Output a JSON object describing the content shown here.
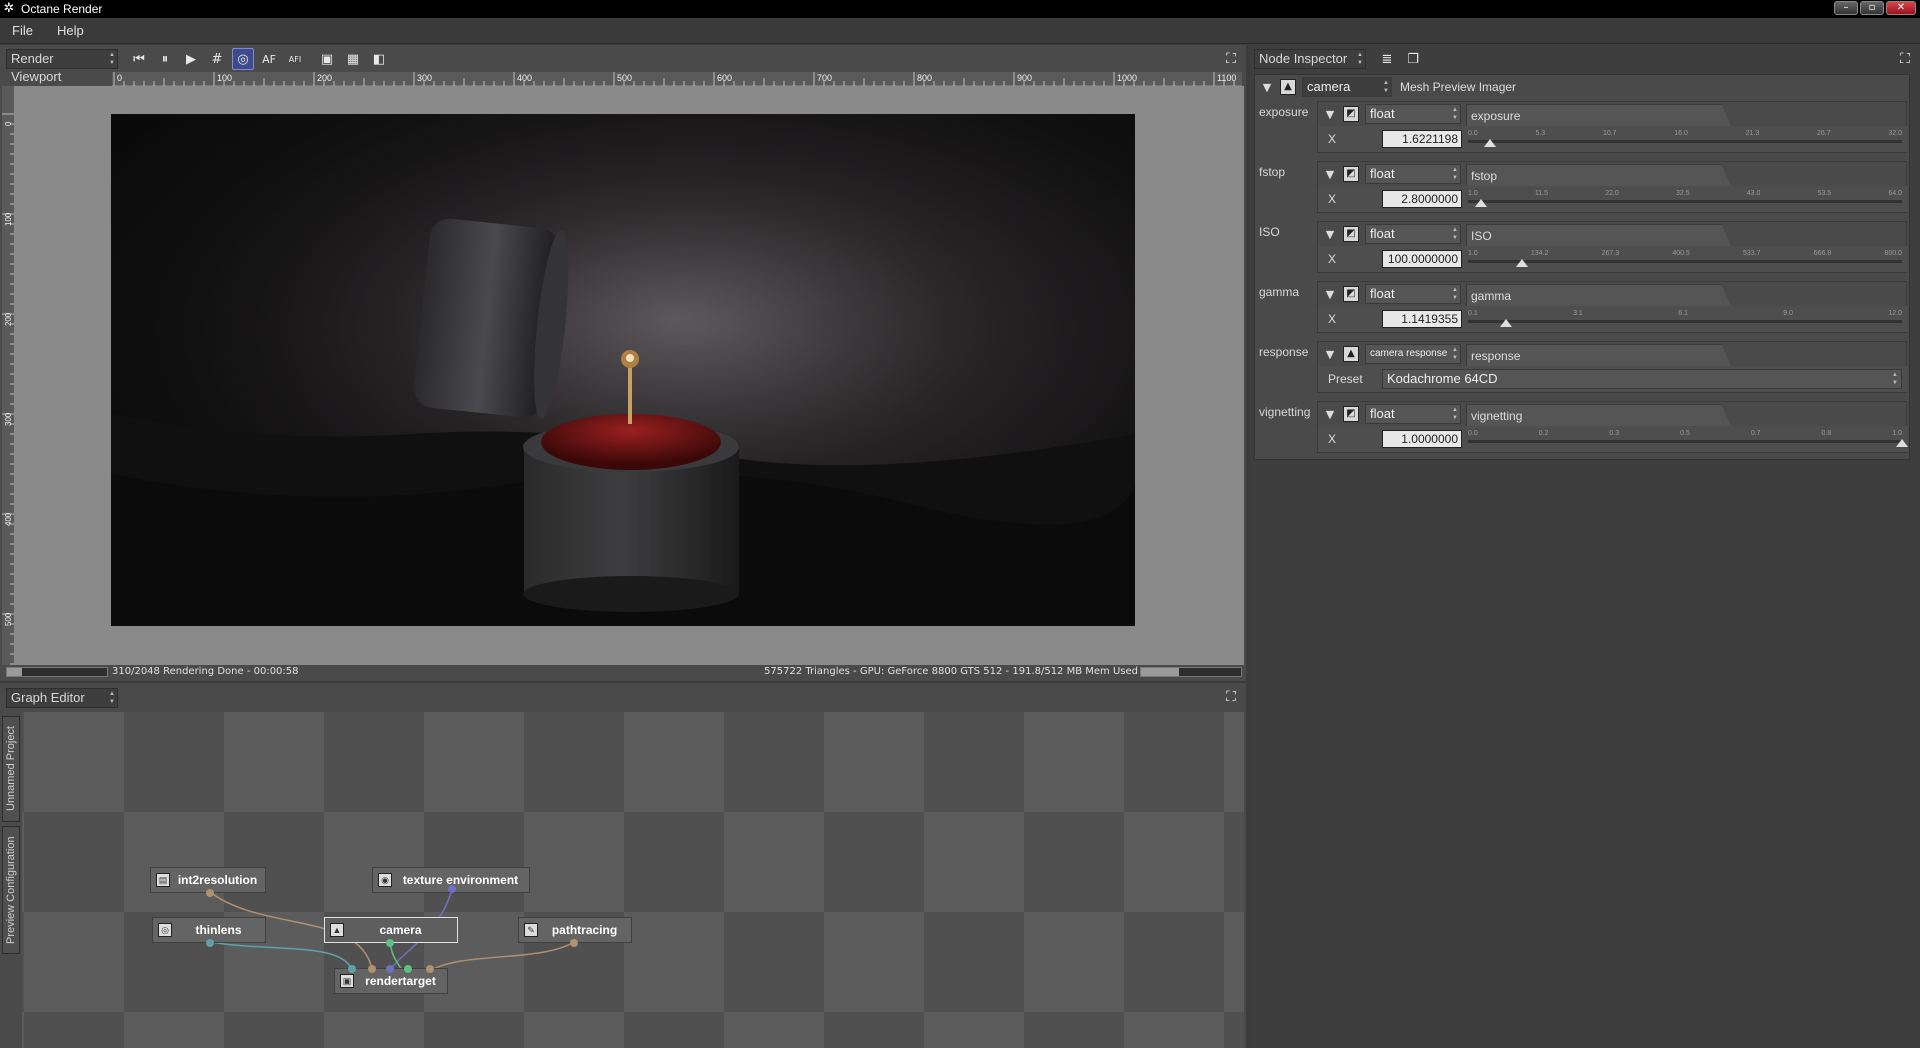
{
  "window": {
    "title": "Octane Render",
    "controls": [
      "–",
      "▫",
      "✕"
    ]
  },
  "menu": [
    "File",
    "Help"
  ],
  "viewport": {
    "panel_label": "Render Viewport",
    "toolbar": {
      "rewind": "⏮",
      "pause": "⏸",
      "play": "▶",
      "grid": "#",
      "focus": "◎",
      "af": "AF",
      "afi": "AFI",
      "region": "▣",
      "checker": "▦",
      "alpha": "◧"
    },
    "ruler_h": [
      "0",
      "100",
      "200",
      "300",
      "400",
      "500",
      "600",
      "700",
      "800",
      "900",
      "1000",
      "1100"
    ],
    "ruler_v": [
      "0",
      "100",
      "200",
      "300",
      "400",
      "500"
    ],
    "status_left": "310/2048 Rendering Done - 00:00:58",
    "status_right": "575722 Triangles - GPU: GeForce 8800 GTS 512 - 191.8/512 MB Mem Used",
    "render_progress": 0.151,
    "memory_usage": 0.375
  },
  "graph_editor": {
    "panel_label": "Graph Editor",
    "side_tabs": [
      "Unnamed Project",
      "Preview Configuration"
    ],
    "nodes": {
      "int2resolution": "int2resolution",
      "texture_environment": "texture environment",
      "thinlens": "thinlens",
      "camera": "camera",
      "pathtracing": "pathtracing",
      "rendertarget": "rendertarget"
    }
  },
  "inspector": {
    "panel_label": "Node Inspector",
    "node_type": "camera",
    "node_title": "Mesh Preview Imager",
    "params": [
      {
        "label": "exposure",
        "type": "float",
        "name": "exposure",
        "axis": "X",
        "value": "1.6221198",
        "ticks": [
          "0.0",
          "5.3",
          "10.7",
          "16.0",
          "21.3",
          "26.7",
          "32.0"
        ],
        "pos": 0.05
      },
      {
        "label": "fstop",
        "type": "float",
        "name": "fstop",
        "axis": "X",
        "value": "2.8000000",
        "ticks": [
          "1.0",
          "11.5",
          "22.0",
          "32.5",
          "43.0",
          "53.5",
          "64.0"
        ],
        "pos": 0.03
      },
      {
        "label": "ISO",
        "type": "float",
        "name": "ISO",
        "axis": "X",
        "value": "100.0000000",
        "ticks": [
          "1.0",
          "134.2",
          "267.3",
          "400.5",
          "533.7",
          "666.8",
          "800.0"
        ],
        "pos": 0.125
      },
      {
        "label": "gamma",
        "type": "float",
        "name": "gamma",
        "axis": "X",
        "value": "1.1419355",
        "ticks": [
          "0.1",
          "3.1",
          "6.1",
          "9.0",
          "12.0"
        ],
        "pos": 0.087
      }
    ],
    "response": {
      "label": "response",
      "type": "camera response",
      "name": "response",
      "preset_label": "Preset",
      "preset_value": "Kodachrome 64CD"
    },
    "vignetting": {
      "label": "vignetting",
      "type": "float",
      "name": "vignetting",
      "axis": "X",
      "value": "1.0000000",
      "ticks": [
        "0.0",
        "0.2",
        "0.3",
        "0.5",
        "0.7",
        "0.8",
        "1.0"
      ],
      "pos": 1.0
    }
  }
}
